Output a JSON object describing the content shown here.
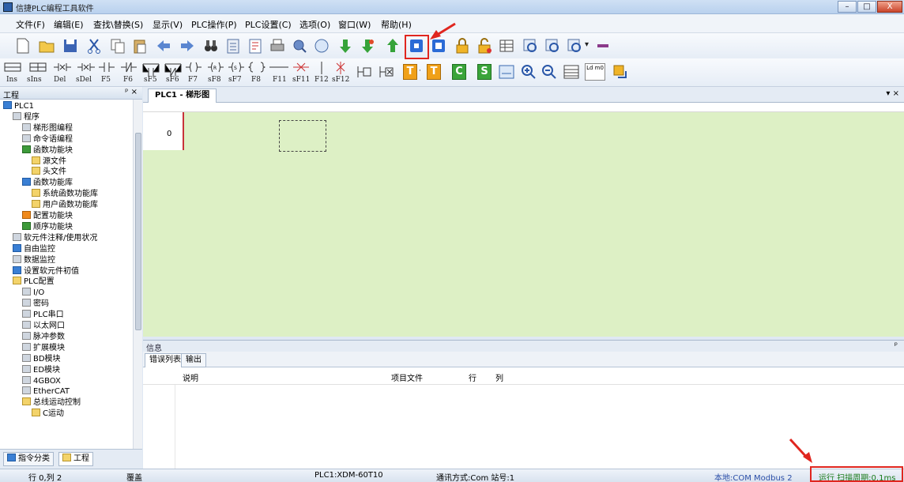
{
  "window": {
    "title": "信捷PLC编程工具软件",
    "controls": [
      "–",
      "□",
      "X"
    ]
  },
  "menu": [
    "文件(F)",
    "编辑(E)",
    "查找\\替换(S)",
    "显示(V)",
    "PLC操作(P)",
    "PLC设置(C)",
    "选项(O)",
    "窗口(W)",
    "帮助(H)"
  ],
  "toolbar2_labels": [
    "Ins",
    "sIns",
    "Del",
    "sDel",
    "F5",
    "F6",
    "sF5",
    "sF6",
    "F7",
    "sF8",
    "sF7",
    "F8",
    "F11",
    "sF11",
    "F12",
    "sF12"
  ],
  "toolbar2_letter_buttons": [
    "T",
    "T",
    "C",
    "S"
  ],
  "toolbar2_ld": "Ld m0",
  "left_panel": {
    "title": "工程",
    "pin": "ᵖ ×",
    "tree": [
      {
        "label": "PLC1",
        "indent": 0
      },
      {
        "label": "程序",
        "indent": 1
      },
      {
        "label": "梯形图编程",
        "indent": 2
      },
      {
        "label": "命令语编程",
        "indent": 2
      },
      {
        "label": "函数功能块",
        "indent": 2
      },
      {
        "label": "源文件",
        "indent": 3
      },
      {
        "label": "头文件",
        "indent": 3
      },
      {
        "label": "函数功能库",
        "indent": 2
      },
      {
        "label": "系统函数功能库",
        "indent": 3
      },
      {
        "label": "用户函数功能库",
        "indent": 3
      },
      {
        "label": "配置功能块",
        "indent": 2
      },
      {
        "label": "顺序功能块",
        "indent": 2
      },
      {
        "label": "软元件注释/使用状况",
        "indent": 1
      },
      {
        "label": "自由监控",
        "indent": 1
      },
      {
        "label": "数据监控",
        "indent": 1
      },
      {
        "label": "设置软元件初值",
        "indent": 1
      },
      {
        "label": "PLC配置",
        "indent": 1
      },
      {
        "label": "I/O",
        "indent": 2
      },
      {
        "label": "密码",
        "indent": 2
      },
      {
        "label": "PLC串口",
        "indent": 2
      },
      {
        "label": "以太网口",
        "indent": 2
      },
      {
        "label": "脉冲参数",
        "indent": 2
      },
      {
        "label": "扩展模块",
        "indent": 2
      },
      {
        "label": "BD模块",
        "indent": 2
      },
      {
        "label": "ED模块",
        "indent": 2
      },
      {
        "label": "4GBOX",
        "indent": 2
      },
      {
        "label": "EtherCAT",
        "indent": 2
      },
      {
        "label": "总线运动控制",
        "indent": 2
      },
      {
        "label": "C运动",
        "indent": 3
      }
    ],
    "tabs": [
      "指令分类",
      "工程"
    ]
  },
  "editor": {
    "tab": "PLC1 - 梯形图",
    "row_number": "0",
    "dropdown": "▾ ×"
  },
  "info": {
    "title": "信息",
    "pin": "ᵖ",
    "tabs": [
      "错误列表",
      "输出"
    ],
    "columns": [
      "说明",
      "项目文件",
      "行",
      "列"
    ]
  },
  "status": {
    "row_col": "行 0,列 2",
    "mode": "覆盖",
    "plc": "PLC1:XDM-60T10",
    "comm": "通讯方式:Com 站号:1",
    "port": "本地:COM Modbus 2",
    "run": "运行 扫描周期:0.1ms"
  },
  "colors": {
    "ladder_bg": "#ddf0c5",
    "annotation_red": "#e0261f",
    "status_run": "#1a7a1a"
  }
}
